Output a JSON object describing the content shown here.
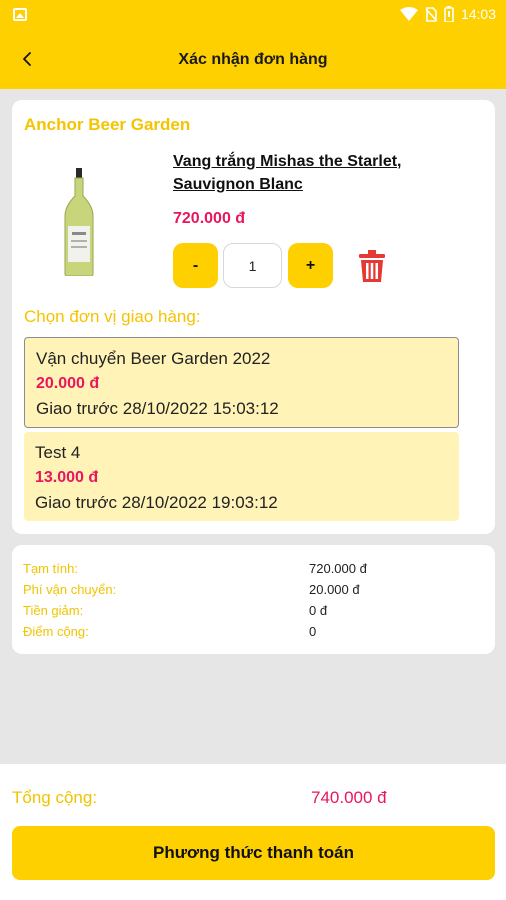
{
  "status_bar": {
    "time": "14:03",
    "icons": [
      "image-icon",
      "wifi-icon",
      "no-sim-icon",
      "battery-icon"
    ],
    "color": "#ffd000"
  },
  "header": {
    "title": "Xác nhận đơn hàng",
    "back_icon": "chevron-left-icon"
  },
  "store": {
    "name": "Anchor Beer Garden"
  },
  "product": {
    "name": "Vang trắng Mishas the Starlet, Sauvignon Blanc",
    "price": "720.000 đ",
    "quantity": "1",
    "minus_label": "-",
    "plus_label": "+",
    "delete_icon": "trash-icon",
    "image_icon": "wine-bottle-icon"
  },
  "shipping": {
    "label": "Chọn đơn vị giao hàng:",
    "options": [
      {
        "name": "Vận chuyển Beer Garden 2022",
        "price": "20.000 đ",
        "time": "Giao trước 28/10/2022 15:03:12",
        "selected": true
      },
      {
        "name": "Test 4",
        "price": "13.000 đ",
        "time": "Giao trước 28/10/2022 19:03:12",
        "selected": false
      }
    ]
  },
  "summary": {
    "rows": [
      {
        "label": "Tạm tính:",
        "value": "720.000 đ"
      },
      {
        "label": "Phí vận chuyển:",
        "value": "20.000 đ"
      },
      {
        "label": "Tiền giảm:",
        "value": "0 đ"
      },
      {
        "label": "Điểm cộng:",
        "value": "0"
      }
    ]
  },
  "footer": {
    "total_label": "Tổng cộng:",
    "total_value": "740.000 đ",
    "pay_button": "Phương thức thanh toán"
  },
  "colors": {
    "brand_yellow": "#ffd000",
    "label_yellow": "#f5c400",
    "price_pink": "#e8175d",
    "delete_red": "#e53935",
    "shipping_bg": "#fff3b8"
  }
}
